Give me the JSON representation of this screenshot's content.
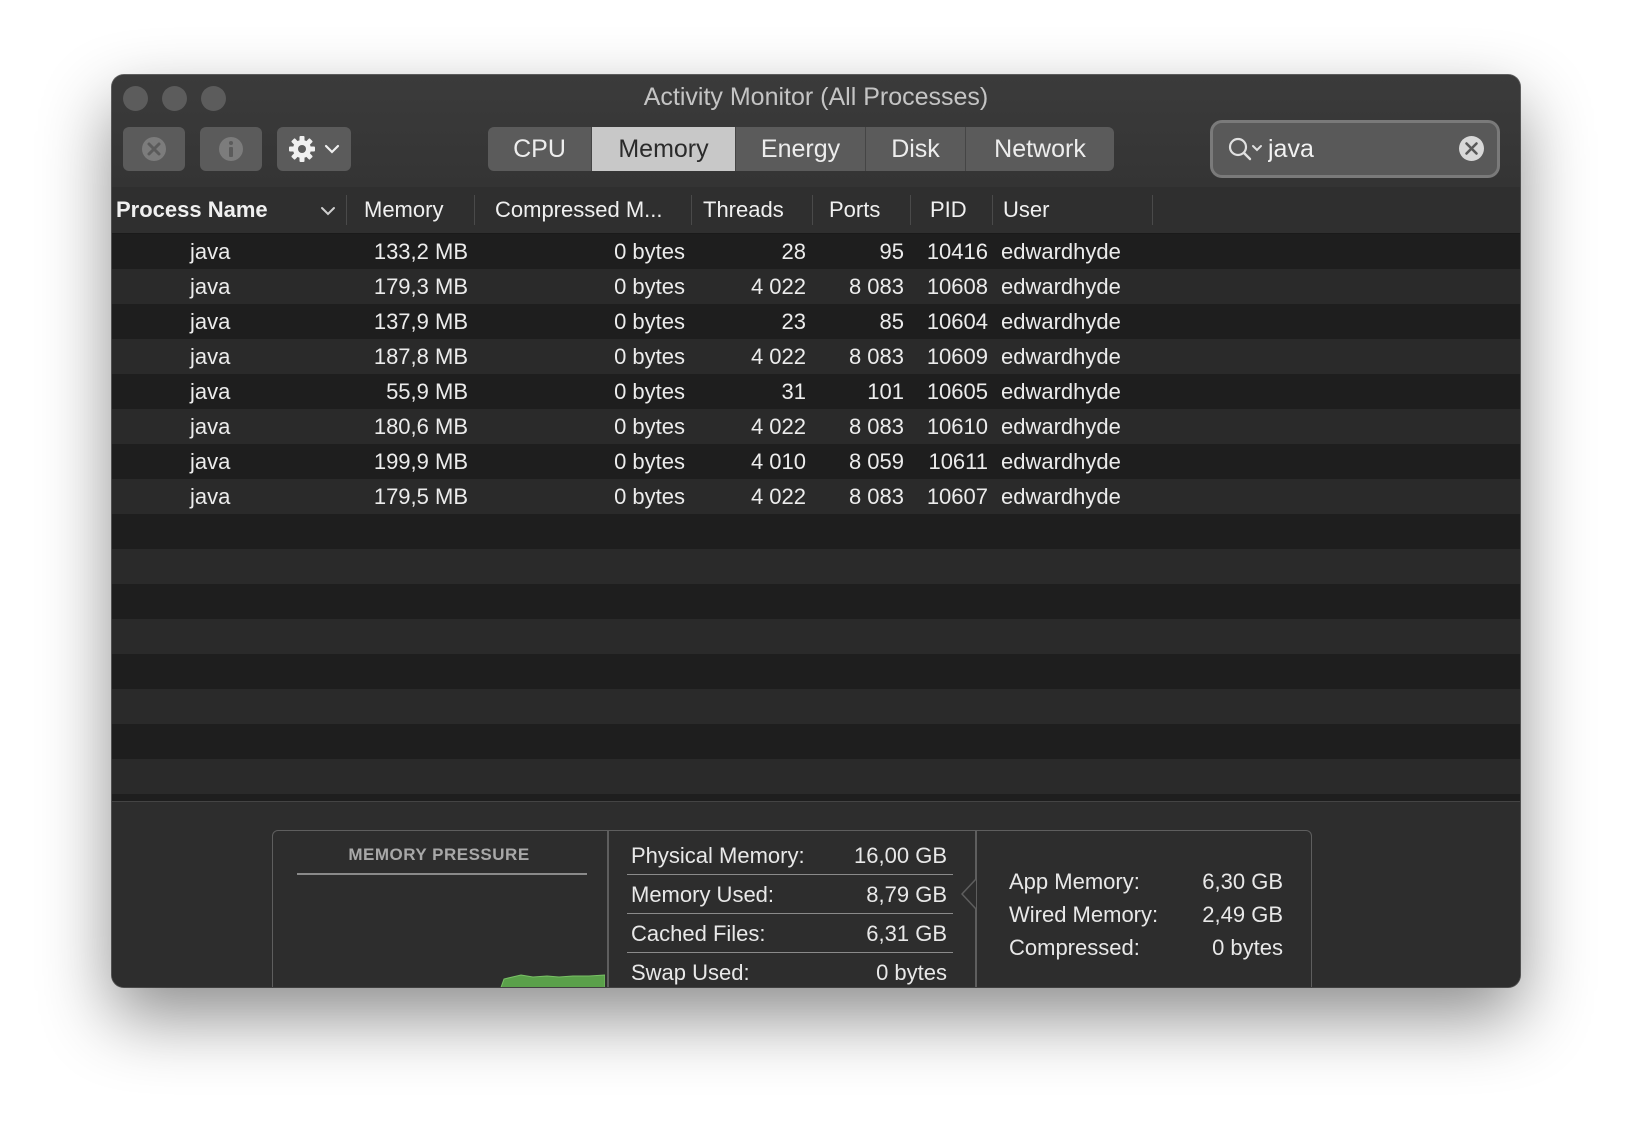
{
  "window": {
    "title": "Activity Monitor (All Processes)"
  },
  "toolbar": {
    "stop_icon": "x-circle-icon",
    "info_icon": "info-icon",
    "action_icon": "gear-icon"
  },
  "tabs": [
    {
      "label": "CPU",
      "active": false
    },
    {
      "label": "Memory",
      "active": true
    },
    {
      "label": "Energy",
      "active": false
    },
    {
      "label": "Disk",
      "active": false
    },
    {
      "label": "Network",
      "active": false
    }
  ],
  "search": {
    "value": "java",
    "placeholder": "Search"
  },
  "table": {
    "columns": [
      {
        "label": "Process Name"
      },
      {
        "label": "Memory"
      },
      {
        "label": "Compressed M..."
      },
      {
        "label": "Threads"
      },
      {
        "label": "Ports"
      },
      {
        "label": "PID"
      },
      {
        "label": "User"
      }
    ],
    "rows": [
      {
        "name": "java",
        "memory": "133,2 MB",
        "compressed": "0 bytes",
        "threads": "28",
        "ports": "95",
        "pid": "10416",
        "user": "edwardhyde"
      },
      {
        "name": "java",
        "memory": "179,3 MB",
        "compressed": "0 bytes",
        "threads": "4 022",
        "ports": "8 083",
        "pid": "10608",
        "user": "edwardhyde"
      },
      {
        "name": "java",
        "memory": "137,9 MB",
        "compressed": "0 bytes",
        "threads": "23",
        "ports": "85",
        "pid": "10604",
        "user": "edwardhyde"
      },
      {
        "name": "java",
        "memory": "187,8 MB",
        "compressed": "0 bytes",
        "threads": "4 022",
        "ports": "8 083",
        "pid": "10609",
        "user": "edwardhyde"
      },
      {
        "name": "java",
        "memory": "55,9 MB",
        "compressed": "0 bytes",
        "threads": "31",
        "ports": "101",
        "pid": "10605",
        "user": "edwardhyde"
      },
      {
        "name": "java",
        "memory": "180,6 MB",
        "compressed": "0 bytes",
        "threads": "4 022",
        "ports": "8 083",
        "pid": "10610",
        "user": "edwardhyde"
      },
      {
        "name": "java",
        "memory": "199,9 MB",
        "compressed": "0 bytes",
        "threads": "4 010",
        "ports": "8 059",
        "pid": "10611",
        "user": "edwardhyde"
      },
      {
        "name": "java",
        "memory": "179,5 MB",
        "compressed": "0 bytes",
        "threads": "4 022",
        "ports": "8 083",
        "pid": "10607",
        "user": "edwardhyde"
      }
    ]
  },
  "memory_pressure": {
    "title": "MEMORY PRESSURE",
    "color": "#5aa04a"
  },
  "stats": {
    "physical": {
      "label": "Physical Memory:",
      "value": "16,00 GB"
    },
    "used": {
      "label": "Memory Used:",
      "value": "8,79 GB"
    },
    "cached": {
      "label": "Cached Files:",
      "value": "6,31 GB"
    },
    "swap": {
      "label": "Swap Used:",
      "value": "0 bytes"
    },
    "app": {
      "label": "App Memory:",
      "value": "6,30 GB"
    },
    "wired": {
      "label": "Wired Memory:",
      "value": "2,49 GB"
    },
    "compressed": {
      "label": "Compressed:",
      "value": "0 bytes"
    }
  }
}
